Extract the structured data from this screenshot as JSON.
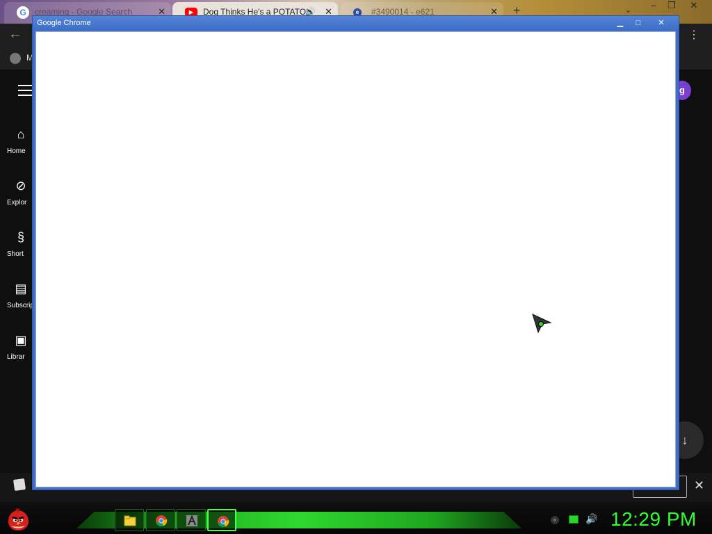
{
  "background_browser": {
    "tabs": [
      {
        "title": "creaming - Google Search",
        "icon": "google-icon"
      },
      {
        "title": "Dog Thinks He's a POTATO!",
        "icon": "youtube-icon"
      },
      {
        "title": "#3490014 - e621",
        "icon": "e621-icon"
      }
    ],
    "bookmark_label": "M",
    "sidebar": [
      {
        "label": "Home",
        "icon": "home-icon"
      },
      {
        "label": "Explor",
        "icon": "explore-icon"
      },
      {
        "label": "Short",
        "icon": "shorts-icon"
      },
      {
        "label": "Subscript",
        "icon": "subscriptions-icon"
      },
      {
        "label": "Librar",
        "icon": "library-icon"
      }
    ],
    "avatar_letter": "g"
  },
  "chrome_window": {
    "title": "Google Chrome",
    "accent_color": "#3c6fc9"
  },
  "taskbar": {
    "clock": "12:29 PM",
    "clock_color": "#2cff2c",
    "items": [
      "file-manager-icon",
      "chrome-icon",
      "app-icon",
      "chrome-icon"
    ]
  }
}
